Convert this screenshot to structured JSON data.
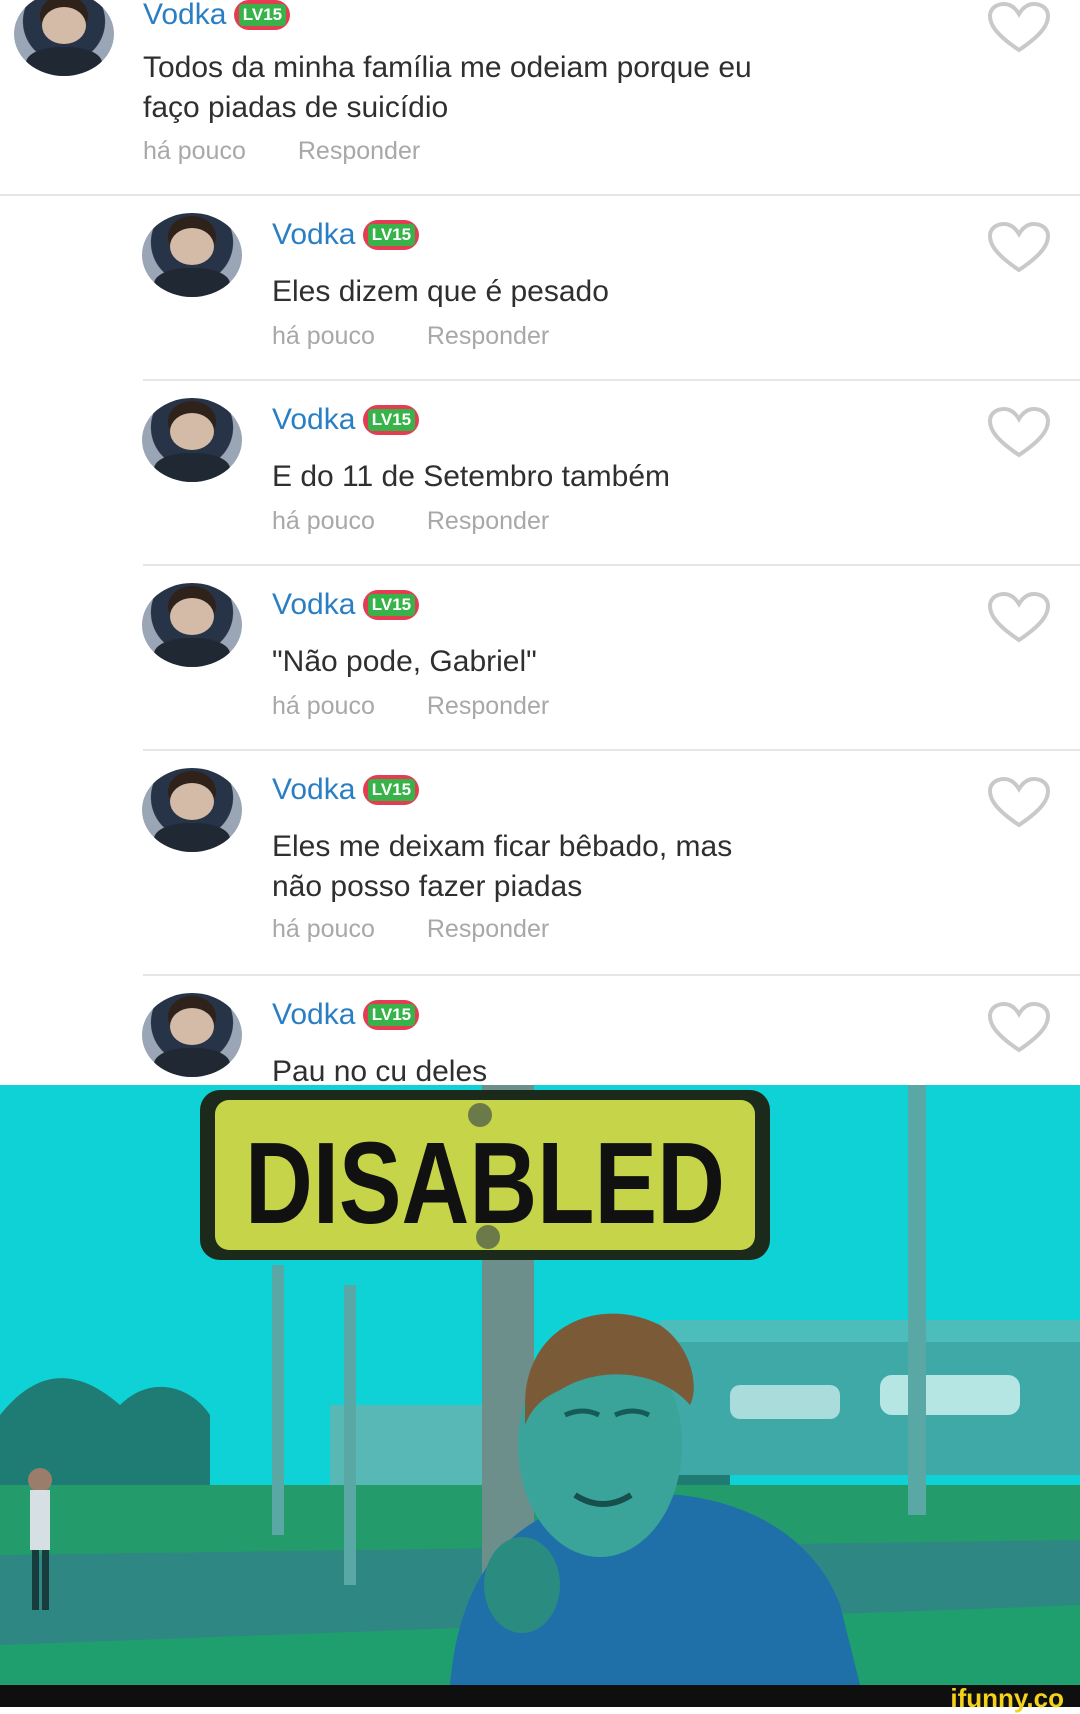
{
  "comments": [
    {
      "name": "Vodka",
      "level": "LV15",
      "lines": [
        "Todos da minha família me odeiam porque eu",
        "faço piadas de suicídio"
      ],
      "time": "há pouco",
      "reply": "Responder"
    },
    {
      "name": "Vodka",
      "level": "LV15",
      "lines": [
        "Eles dizem que é pesado"
      ],
      "time": "há pouco",
      "reply": "Responder"
    },
    {
      "name": "Vodka",
      "level": "LV15",
      "lines": [
        "E do 11 de Setembro também"
      ],
      "time": "há pouco",
      "reply": "Responder"
    },
    {
      "name": "Vodka",
      "level": "LV15",
      "lines": [
        "\"Não pode, Gabriel\""
      ],
      "time": "há pouco",
      "reply": "Responder"
    },
    {
      "name": "Vodka",
      "level": "LV15",
      "lines": [
        "Eles me deixam ficar bêbado, mas",
        "não posso fazer piadas"
      ],
      "time": "há pouco",
      "reply": "Responder"
    },
    {
      "name": "Vodka",
      "level": "LV15",
      "lines": [
        "Pau no cu deles"
      ],
      "time": "",
      "reply": ""
    }
  ],
  "meme": {
    "sign_text": "DISABLED"
  },
  "watermark": "ifunny.co",
  "colors": {
    "name": "#2a7fc4",
    "sign": "#c6d44a",
    "tint": "#0fd2d6"
  }
}
